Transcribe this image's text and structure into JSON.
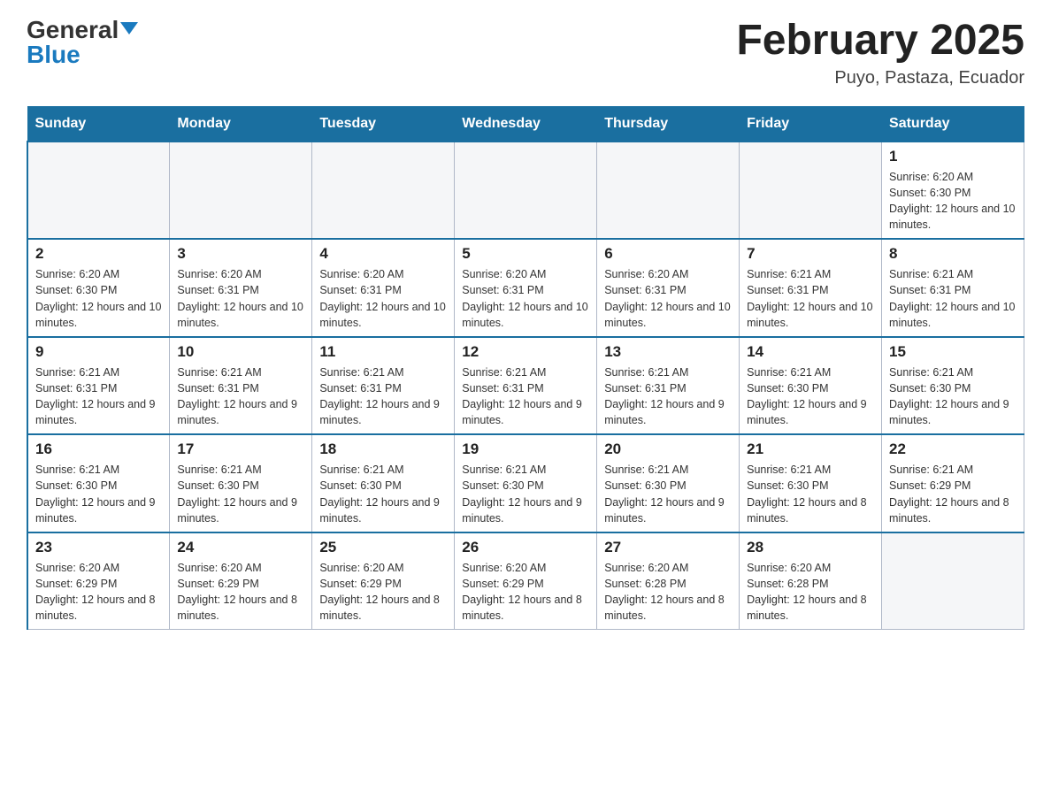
{
  "header": {
    "logo_general": "General",
    "logo_blue": "Blue",
    "month_title": "February 2025",
    "location": "Puyo, Pastaza, Ecuador"
  },
  "days_of_week": [
    "Sunday",
    "Monday",
    "Tuesday",
    "Wednesday",
    "Thursday",
    "Friday",
    "Saturday"
  ],
  "weeks": [
    [
      {
        "day": "",
        "info": ""
      },
      {
        "day": "",
        "info": ""
      },
      {
        "day": "",
        "info": ""
      },
      {
        "day": "",
        "info": ""
      },
      {
        "day": "",
        "info": ""
      },
      {
        "day": "",
        "info": ""
      },
      {
        "day": "1",
        "info": "Sunrise: 6:20 AM\nSunset: 6:30 PM\nDaylight: 12 hours and 10 minutes."
      }
    ],
    [
      {
        "day": "2",
        "info": "Sunrise: 6:20 AM\nSunset: 6:30 PM\nDaylight: 12 hours and 10 minutes."
      },
      {
        "day": "3",
        "info": "Sunrise: 6:20 AM\nSunset: 6:31 PM\nDaylight: 12 hours and 10 minutes."
      },
      {
        "day": "4",
        "info": "Sunrise: 6:20 AM\nSunset: 6:31 PM\nDaylight: 12 hours and 10 minutes."
      },
      {
        "day": "5",
        "info": "Sunrise: 6:20 AM\nSunset: 6:31 PM\nDaylight: 12 hours and 10 minutes."
      },
      {
        "day": "6",
        "info": "Sunrise: 6:20 AM\nSunset: 6:31 PM\nDaylight: 12 hours and 10 minutes."
      },
      {
        "day": "7",
        "info": "Sunrise: 6:21 AM\nSunset: 6:31 PM\nDaylight: 12 hours and 10 minutes."
      },
      {
        "day": "8",
        "info": "Sunrise: 6:21 AM\nSunset: 6:31 PM\nDaylight: 12 hours and 10 minutes."
      }
    ],
    [
      {
        "day": "9",
        "info": "Sunrise: 6:21 AM\nSunset: 6:31 PM\nDaylight: 12 hours and 9 minutes."
      },
      {
        "day": "10",
        "info": "Sunrise: 6:21 AM\nSunset: 6:31 PM\nDaylight: 12 hours and 9 minutes."
      },
      {
        "day": "11",
        "info": "Sunrise: 6:21 AM\nSunset: 6:31 PM\nDaylight: 12 hours and 9 minutes."
      },
      {
        "day": "12",
        "info": "Sunrise: 6:21 AM\nSunset: 6:31 PM\nDaylight: 12 hours and 9 minutes."
      },
      {
        "day": "13",
        "info": "Sunrise: 6:21 AM\nSunset: 6:31 PM\nDaylight: 12 hours and 9 minutes."
      },
      {
        "day": "14",
        "info": "Sunrise: 6:21 AM\nSunset: 6:30 PM\nDaylight: 12 hours and 9 minutes."
      },
      {
        "day": "15",
        "info": "Sunrise: 6:21 AM\nSunset: 6:30 PM\nDaylight: 12 hours and 9 minutes."
      }
    ],
    [
      {
        "day": "16",
        "info": "Sunrise: 6:21 AM\nSunset: 6:30 PM\nDaylight: 12 hours and 9 minutes."
      },
      {
        "day": "17",
        "info": "Sunrise: 6:21 AM\nSunset: 6:30 PM\nDaylight: 12 hours and 9 minutes."
      },
      {
        "day": "18",
        "info": "Sunrise: 6:21 AM\nSunset: 6:30 PM\nDaylight: 12 hours and 9 minutes."
      },
      {
        "day": "19",
        "info": "Sunrise: 6:21 AM\nSunset: 6:30 PM\nDaylight: 12 hours and 9 minutes."
      },
      {
        "day": "20",
        "info": "Sunrise: 6:21 AM\nSunset: 6:30 PM\nDaylight: 12 hours and 9 minutes."
      },
      {
        "day": "21",
        "info": "Sunrise: 6:21 AM\nSunset: 6:30 PM\nDaylight: 12 hours and 8 minutes."
      },
      {
        "day": "22",
        "info": "Sunrise: 6:21 AM\nSunset: 6:29 PM\nDaylight: 12 hours and 8 minutes."
      }
    ],
    [
      {
        "day": "23",
        "info": "Sunrise: 6:20 AM\nSunset: 6:29 PM\nDaylight: 12 hours and 8 minutes."
      },
      {
        "day": "24",
        "info": "Sunrise: 6:20 AM\nSunset: 6:29 PM\nDaylight: 12 hours and 8 minutes."
      },
      {
        "day": "25",
        "info": "Sunrise: 6:20 AM\nSunset: 6:29 PM\nDaylight: 12 hours and 8 minutes."
      },
      {
        "day": "26",
        "info": "Sunrise: 6:20 AM\nSunset: 6:29 PM\nDaylight: 12 hours and 8 minutes."
      },
      {
        "day": "27",
        "info": "Sunrise: 6:20 AM\nSunset: 6:28 PM\nDaylight: 12 hours and 8 minutes."
      },
      {
        "day": "28",
        "info": "Sunrise: 6:20 AM\nSunset: 6:28 PM\nDaylight: 12 hours and 8 minutes."
      },
      {
        "day": "",
        "info": ""
      }
    ]
  ]
}
